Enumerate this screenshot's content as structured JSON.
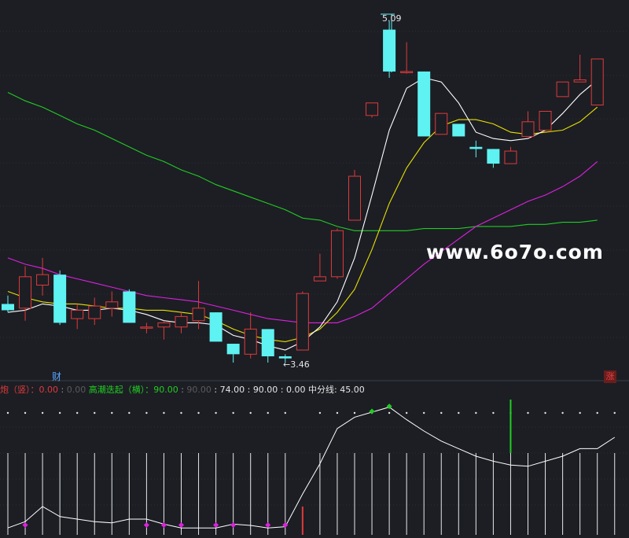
{
  "labels": {
    "high_price": "5.09",
    "low_price": "3.46",
    "finance_marker": "财",
    "rise_badge": "涨",
    "watermark": "www.6o7o.com"
  },
  "indicator_legend": {
    "item1_name": "炮（竖）",
    "item1_value": "0.00",
    "item2_value": "0.00",
    "item3_name": "高潮迭起（横）",
    "item3_value": "90.00",
    "item4_value": "90.00",
    "item5_value": "74.00",
    "item6_value": "90.00",
    "item7_value": "0.00",
    "item8_name": "中分线",
    "item8_value": "45.00"
  },
  "colors": {
    "background": "#1c1e24",
    "up_candle": "#e03a3a",
    "down_candle": "#5ef2f2",
    "ma_white": "#ffffff",
    "ma_yellow": "#e8e000",
    "ma_magenta": "#e020e0",
    "ma_green": "#22cc22",
    "legend_red": "#e03a3a",
    "legend_green": "#22cc22",
    "legend_gray": "#9a9a9a",
    "legend_white": "#e6e6e6"
  },
  "chart_data": {
    "type": "candlestick",
    "price_range": [
      3.2,
      5.2
    ],
    "candles": [
      {
        "o": 3.74,
        "h": 3.78,
        "l": 3.7,
        "c": 3.71
      },
      {
        "o": 3.72,
        "h": 3.92,
        "l": 3.66,
        "c": 3.87
      },
      {
        "o": 3.83,
        "h": 3.96,
        "l": 3.78,
        "c": 3.88
      },
      {
        "o": 3.88,
        "h": 3.9,
        "l": 3.64,
        "c": 3.65
      },
      {
        "o": 3.67,
        "h": 3.74,
        "l": 3.62,
        "c": 3.71
      },
      {
        "o": 3.67,
        "h": 3.77,
        "l": 3.64,
        "c": 3.73
      },
      {
        "o": 3.72,
        "h": 3.8,
        "l": 3.68,
        "c": 3.75
      },
      {
        "o": 3.8,
        "h": 3.81,
        "l": 3.65,
        "c": 3.65
      },
      {
        "o": 3.63,
        "h": 3.65,
        "l": 3.6,
        "c": 3.63
      },
      {
        "o": 3.63,
        "h": 3.66,
        "l": 3.57,
        "c": 3.65
      },
      {
        "o": 3.63,
        "h": 3.7,
        "l": 3.6,
        "c": 3.68
      },
      {
        "o": 3.66,
        "h": 3.85,
        "l": 3.62,
        "c": 3.72
      },
      {
        "o": 3.7,
        "h": 3.7,
        "l": 3.57,
        "c": 3.56
      },
      {
        "o": 3.55,
        "h": 3.55,
        "l": 3.46,
        "c": 3.5
      },
      {
        "o": 3.5,
        "h": 3.7,
        "l": 3.48,
        "c": 3.62
      },
      {
        "o": 3.62,
        "h": 3.62,
        "l": 3.46,
        "c": 3.49
      },
      {
        "o": 3.49,
        "h": 3.5,
        "l": 3.46,
        "c": 3.48
      },
      {
        "o": 3.52,
        "h": 3.8,
        "l": 3.52,
        "c": 3.79
      },
      {
        "o": 3.85,
        "h": 3.98,
        "l": 3.85,
        "c": 3.87
      },
      {
        "o": 3.87,
        "h": 4.1,
        "l": 3.86,
        "c": 4.09
      },
      {
        "o": 4.14,
        "h": 4.38,
        "l": 4.14,
        "c": 4.35
      },
      {
        "o": 4.64,
        "h": 4.7,
        "l": 4.63,
        "c": 4.7
      },
      {
        "o": 5.05,
        "h": 5.09,
        "l": 4.82,
        "c": 4.85
      },
      {
        "o": 4.85,
        "h": 4.99,
        "l": 4.84,
        "c": 4.85
      },
      {
        "o": 4.85,
        "h": 4.85,
        "l": 4.55,
        "c": 4.54
      },
      {
        "o": 4.55,
        "h": 4.65,
        "l": 4.6,
        "c": 4.65
      },
      {
        "o": 4.6,
        "h": 4.6,
        "l": 4.54,
        "c": 4.54
      },
      {
        "o": 4.49,
        "h": 4.52,
        "l": 4.44,
        "c": 4.48
      },
      {
        "o": 4.48,
        "h": 4.48,
        "l": 4.39,
        "c": 4.41
      },
      {
        "o": 4.41,
        "h": 4.49,
        "l": 4.41,
        "c": 4.47
      },
      {
        "o": 4.54,
        "h": 4.66,
        "l": 4.54,
        "c": 4.61
      },
      {
        "o": 4.57,
        "h": 4.66,
        "l": 4.57,
        "c": 4.66
      },
      {
        "o": 4.73,
        "h": 4.8,
        "l": 4.73,
        "c": 4.8
      },
      {
        "o": 4.8,
        "h": 4.93,
        "l": 4.8,
        "c": 4.81
      },
      {
        "o": 4.69,
        "h": 4.91,
        "l": 4.69,
        "c": 4.91
      }
    ],
    "ma_white": [
      3.7,
      3.71,
      3.74,
      3.73,
      3.71,
      3.71,
      3.72,
      3.71,
      3.69,
      3.66,
      3.65,
      3.65,
      3.64,
      3.59,
      3.57,
      3.54,
      3.52,
      3.56,
      3.63,
      3.75,
      3.96,
      4.26,
      4.57,
      4.77,
      4.82,
      4.8,
      4.7,
      4.56,
      4.53,
      4.52,
      4.53,
      4.57,
      4.65,
      4.74,
      4.81
    ],
    "ma_yellow": [
      3.8,
      3.77,
      3.75,
      3.74,
      3.74,
      3.73,
      3.72,
      3.72,
      3.71,
      3.71,
      3.7,
      3.69,
      3.66,
      3.62,
      3.59,
      3.57,
      3.56,
      3.58,
      3.62,
      3.7,
      3.81,
      4.0,
      4.22,
      4.39,
      4.51,
      4.59,
      4.62,
      4.62,
      4.6,
      4.56,
      4.55,
      4.56,
      4.57,
      4.61,
      4.68
    ],
    "ma_magenta": [
      3.96,
      3.93,
      3.91,
      3.88,
      3.86,
      3.84,
      3.82,
      3.8,
      3.78,
      3.77,
      3.76,
      3.75,
      3.73,
      3.71,
      3.69,
      3.67,
      3.66,
      3.65,
      3.65,
      3.65,
      3.68,
      3.72,
      3.79,
      3.86,
      3.93,
      3.99,
      4.05,
      4.11,
      4.15,
      4.19,
      4.23,
      4.26,
      4.3,
      4.35,
      4.42
    ],
    "ma_green": [
      4.75,
      4.71,
      4.68,
      4.64,
      4.6,
      4.57,
      4.53,
      4.49,
      4.45,
      4.42,
      4.38,
      4.35,
      4.31,
      4.28,
      4.25,
      4.22,
      4.19,
      4.15,
      4.14,
      4.11,
      4.09,
      4.09,
      4.09,
      4.09,
      4.1,
      4.1,
      4.1,
      4.11,
      4.11,
      4.11,
      4.12,
      4.12,
      4.13,
      4.13,
      4.14
    ],
    "indicator_range": [
      0,
      100
    ],
    "indicator_line": [
      3,
      8,
      20,
      12,
      10,
      8,
      7,
      10,
      10,
      6,
      3,
      3,
      3,
      6,
      5,
      3,
      4,
      30,
      54,
      82,
      91,
      95,
      99,
      89,
      80,
      72,
      66,
      60,
      56,
      53,
      52,
      56,
      60,
      66,
      66,
      75
    ],
    "magenta_dots_at": [
      1,
      8,
      9,
      10,
      12,
      13,
      15,
      16
    ],
    "green_dots_at": [
      21,
      22
    ],
    "red_signal_at": 17,
    "green_signal_at": 29
  }
}
